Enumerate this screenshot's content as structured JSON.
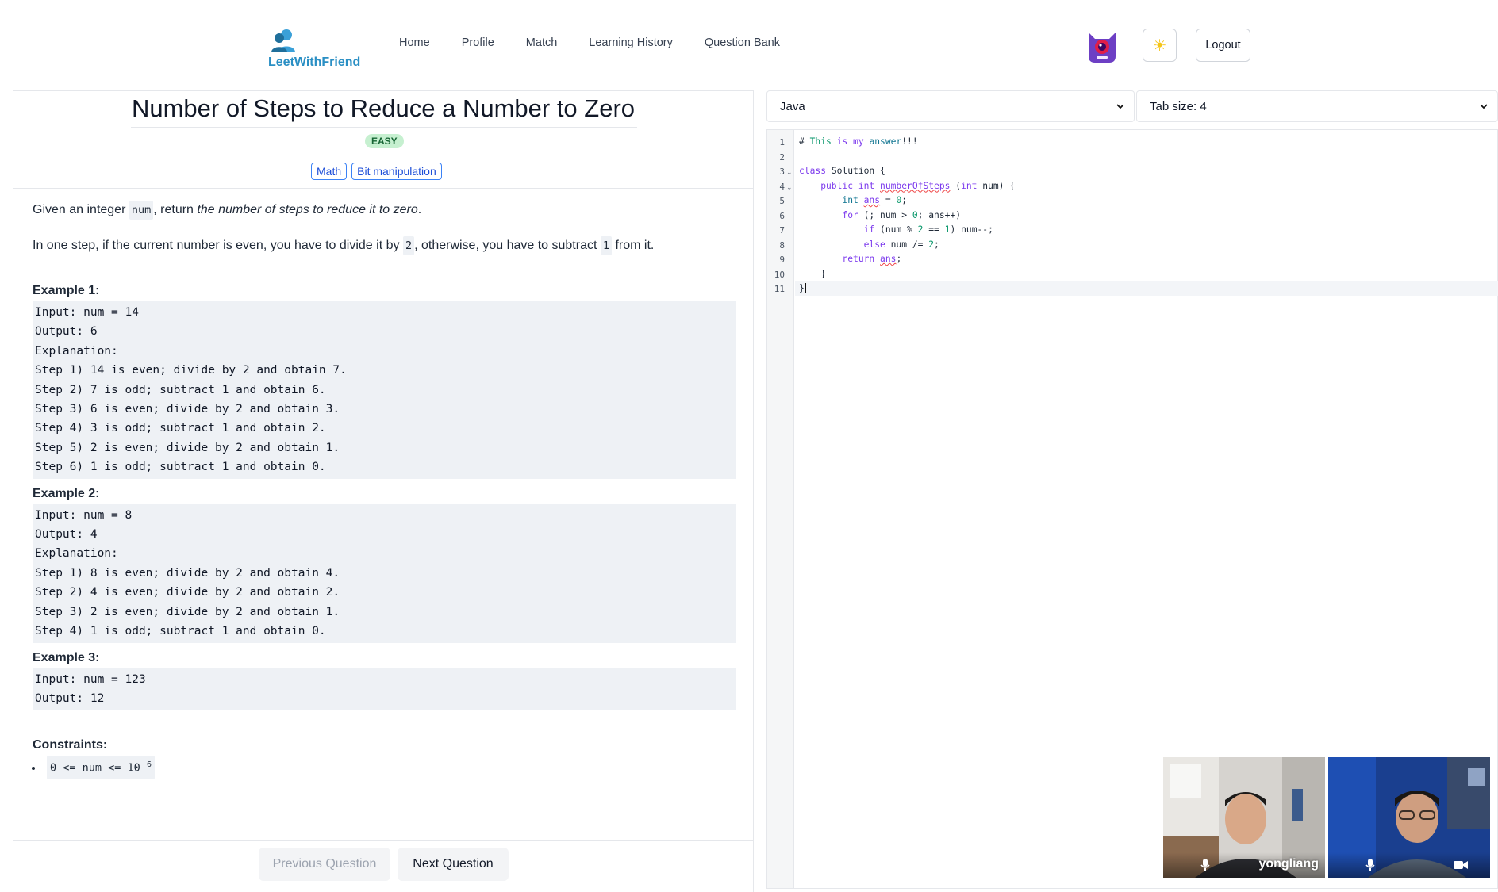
{
  "app": {
    "name": "LeetWithFriend"
  },
  "nav": {
    "items": [
      "Home",
      "Profile",
      "Match",
      "Learning History",
      "Question Bank"
    ],
    "logout_label": "Logout",
    "theme_icon": "sun-icon"
  },
  "question": {
    "title": "Number of Steps to Reduce a Number to Zero",
    "difficulty": "EASY",
    "tags": [
      "Math",
      "Bit manipulation"
    ],
    "intro_1": "Given an integer ",
    "intro_code": "num",
    "intro_2": ", return ",
    "intro_em": "the number of steps to reduce it to zero",
    "intro_3": ".",
    "step_1": "In one step, if the current number is even, you have to divide it by ",
    "step_code1": "2",
    "step_2": ", otherwise, you have to subtract ",
    "step_code2": "1",
    "step_3": " from it.",
    "examples": [
      {
        "title": "Example 1:",
        "text": "Input: num = 14\nOutput: 6\nExplanation:\nStep 1) 14 is even; divide by 2 and obtain 7.\nStep 2) 7 is odd; subtract 1 and obtain 6.\nStep 3) 6 is even; divide by 2 and obtain 3.\nStep 4) 3 is odd; subtract 1 and obtain 2.\nStep 5) 2 is even; divide by 2 and obtain 1.\nStep 6) 1 is odd; subtract 1 and obtain 0."
      },
      {
        "title": "Example 2:",
        "text": "Input: num = 8\nOutput: 4\nExplanation:\nStep 1) 8 is even; divide by 2 and obtain 4.\nStep 2) 4 is even; divide by 2 and obtain 2.\nStep 3) 2 is even; divide by 2 and obtain 1.\nStep 4) 1 is odd; subtract 1 and obtain 0."
      },
      {
        "title": "Example 3:",
        "text": "Input: num = 123\nOutput: 12"
      }
    ],
    "constraints_title": "Constraints:",
    "constraint_base": "0 <= num <= 10",
    "constraint_exp": "6",
    "prev_label": "Previous Question",
    "next_label": "Next Question"
  },
  "editor": {
    "language": "Java",
    "tab_size": "Tab size: 4",
    "line_numbers": [
      "1",
      "2",
      "3",
      "4",
      "5",
      "6",
      "7",
      "8",
      "9",
      "10",
      "11"
    ],
    "code": {
      "l1a": "# ",
      "l1b": "This ",
      "l1c": "is ",
      "l1d": "my ",
      "l1e": "answer",
      "l1f": "!!!",
      "l3a": "class ",
      "l3b": "Solution {",
      "l4a": "    public int ",
      "l4b": "numberOfSteps",
      "l4c": " (",
      "l4d": "int",
      "l4e": " num) {",
      "l5a": "        int ",
      "l5b": "ans",
      "l5c": " = ",
      "l5d": "0",
      "l5e": ";",
      "l6a": "        for ",
      "l6b": "(; num > ",
      "l6c": "0",
      "l6d": "; ans++)",
      "l7a": "            if ",
      "l7b": "(num % ",
      "l7c": "2",
      "l7d": " == ",
      "l7e": "1",
      "l7f": ") num--;",
      "l8a": "            else ",
      "l8b": "num /= ",
      "l8c": "2",
      "l8d": ";",
      "l9a": "        return ",
      "l9b": "ans",
      "l9c": ";",
      "l10": "    }",
      "l11": "}"
    }
  },
  "call": {
    "participants": [
      {
        "name": "yongliang"
      },
      {
        "name": ""
      }
    ]
  },
  "colors": {
    "brand": "#2a8fc4",
    "tag": "#3b82f6",
    "easy_bg": "#c6f0d0"
  }
}
